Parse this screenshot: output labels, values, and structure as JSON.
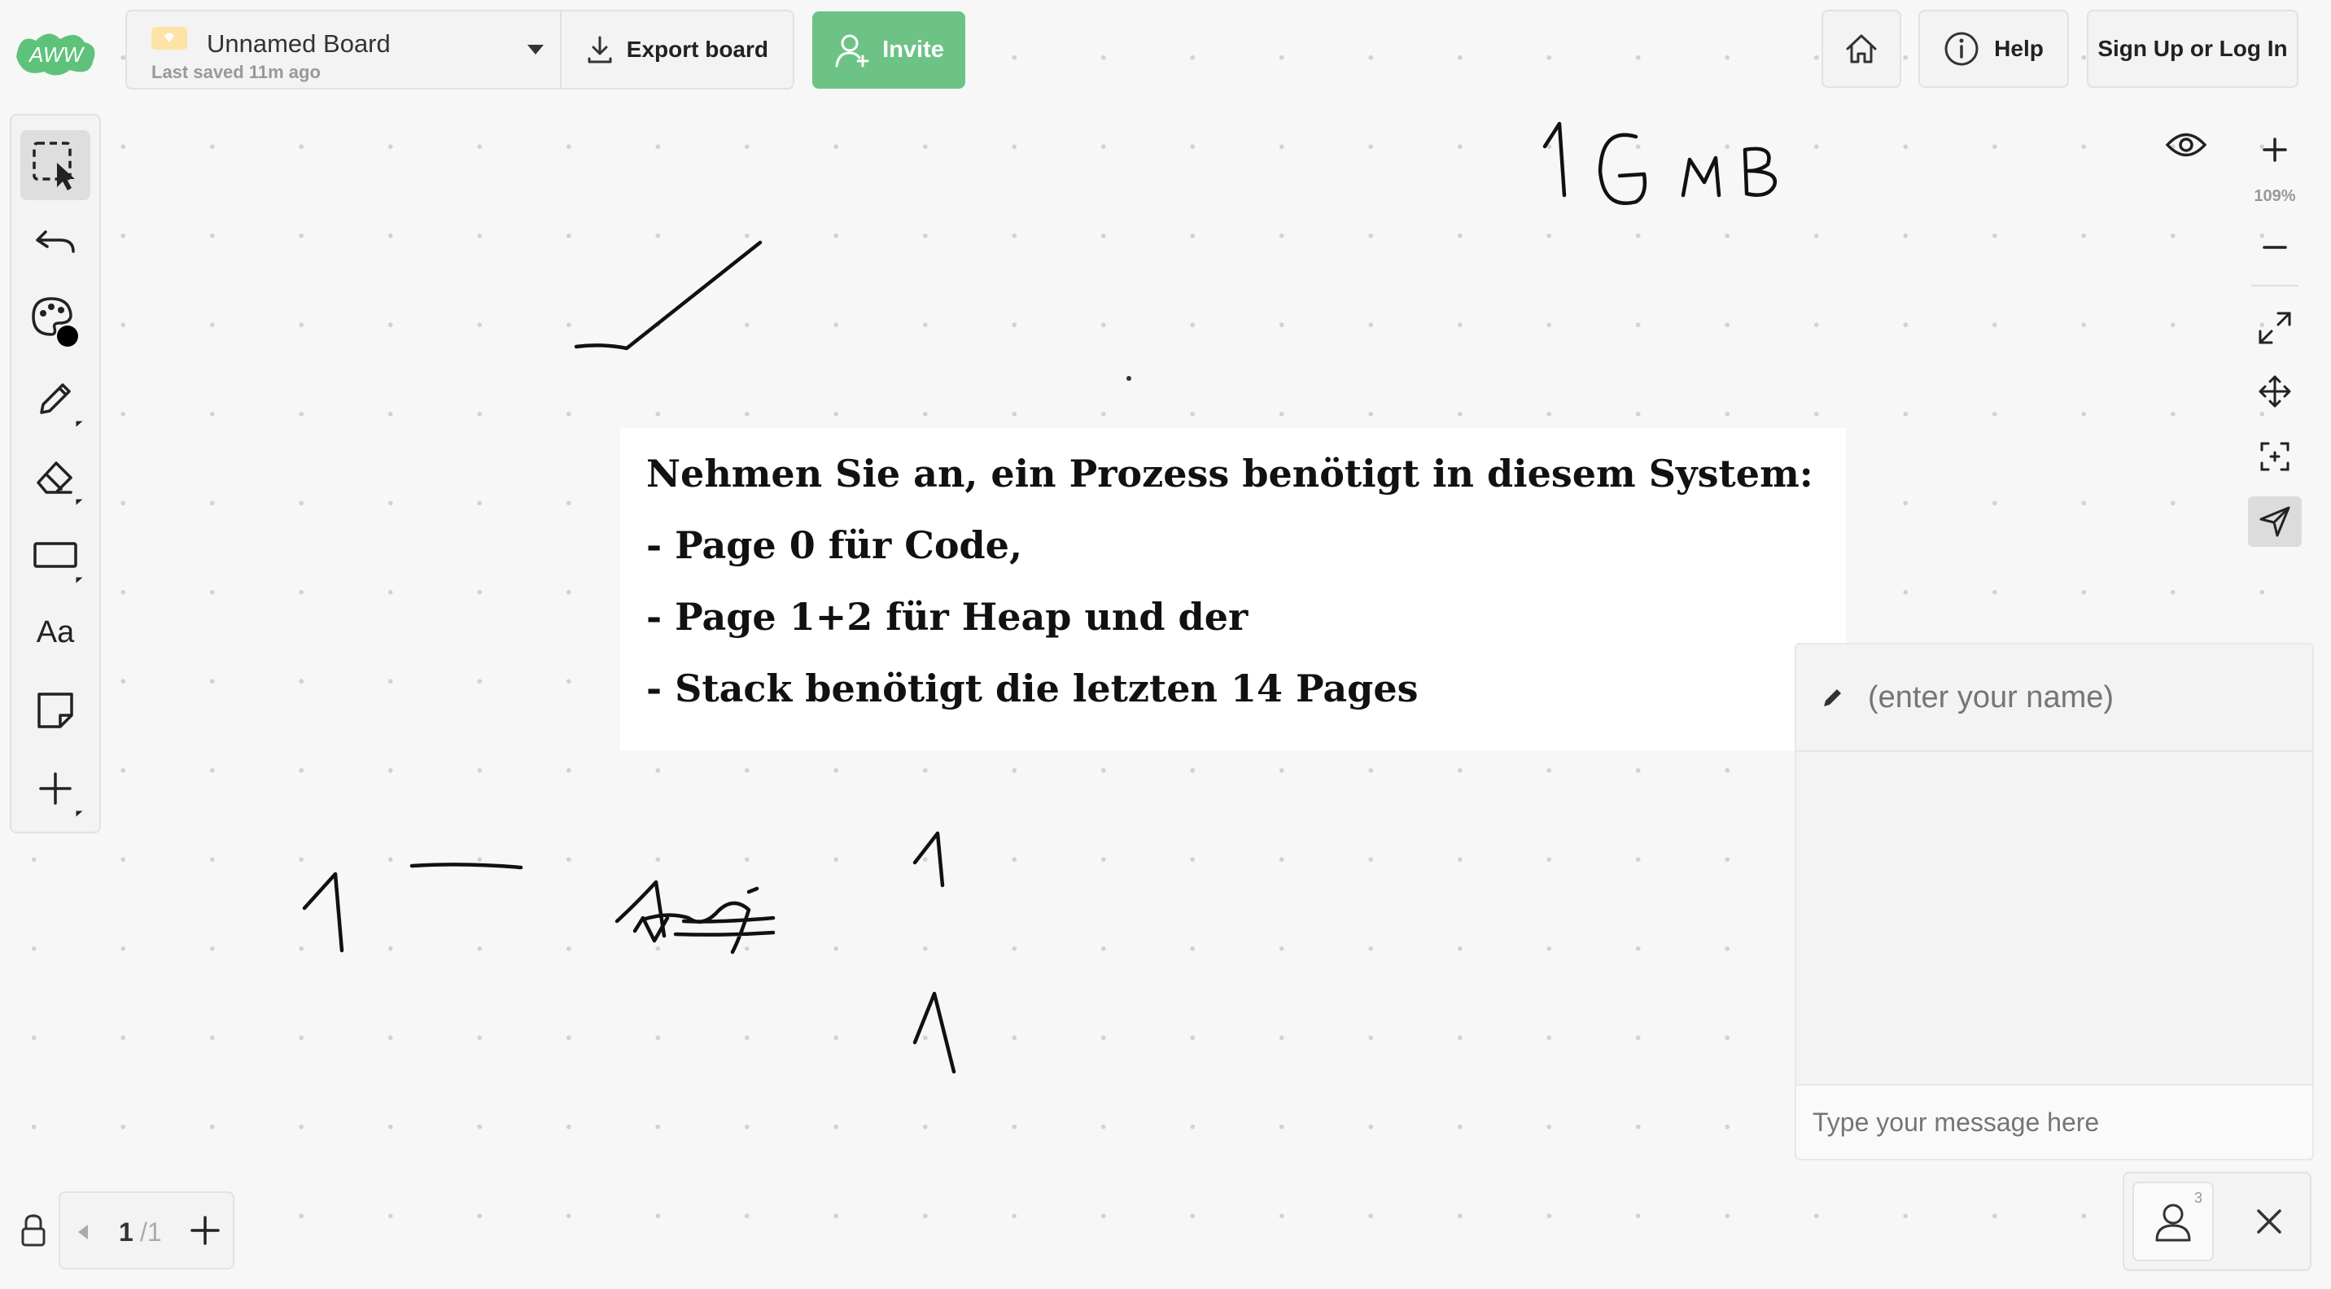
{
  "app": {
    "logo_text": "AWW"
  },
  "header": {
    "board_title": "Unnamed Board",
    "last_saved": "Last saved 11m ago",
    "export_label": "Export board",
    "invite_label": "Invite",
    "help_label": "Help",
    "auth_label": "Sign Up or Log In"
  },
  "toolbar": {
    "tools": [
      "select-icon",
      "undo-icon",
      "palette-icon",
      "pencil-icon",
      "eraser-icon",
      "rectangle-icon",
      "text-tool",
      "sticky-note-icon",
      "add-icon"
    ],
    "text_tool_label": "Aa",
    "active_tool": "select",
    "current_color": "#000000"
  },
  "zoom": {
    "level": "109%"
  },
  "canvas": {
    "text_box_lines": [
      "Nehmen Sie an, ein Prozess benötigt in diesem System:",
      "- Page 0 für Code,",
      "- Page 1+2 für Heap und der",
      "- Stack benötigt die letzten 14 Pages"
    ],
    "handwriting": {
      "top_right": "16MB",
      "marks": [
        "1",
        "—",
        "1",
        "1"
      ]
    }
  },
  "chat": {
    "name_placeholder": "(enter your name)",
    "message_placeholder": "Type your message here"
  },
  "users": {
    "count": "3"
  },
  "pages": {
    "current": "1",
    "total": "/1"
  },
  "colors": {
    "invite": "#6cc385",
    "accent_logo": "#5fc27a"
  }
}
